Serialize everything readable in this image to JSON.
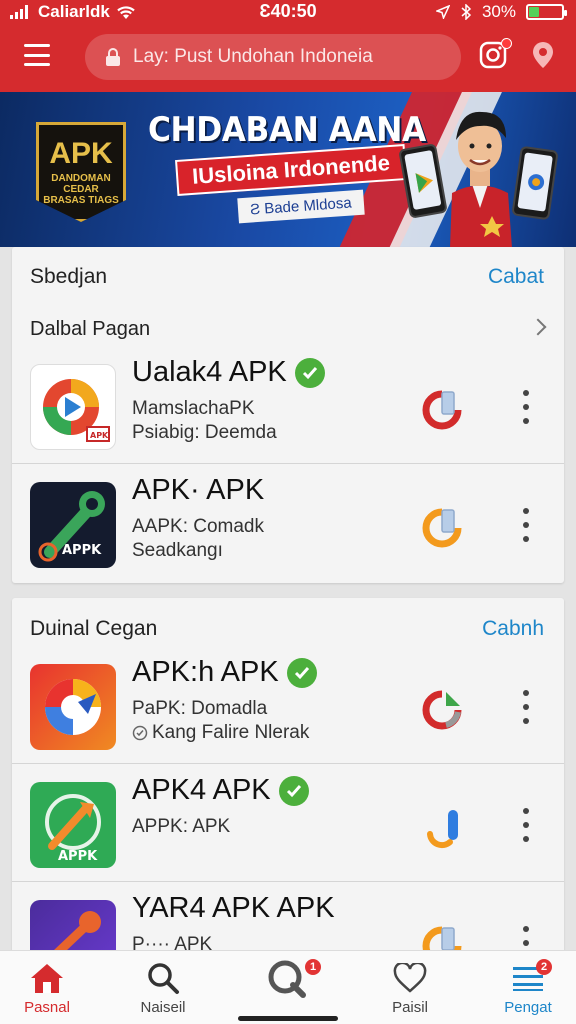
{
  "status_bar": {
    "carrier": "Caliarldk",
    "time": "Ɛ40:50",
    "battery": "30%",
    "battery_level": 0.3
  },
  "header": {
    "search_placeholder": "Lay: Pust Undohan Indoneia",
    "icons": [
      "menu-icon",
      "lock-icon",
      "instagram-icon",
      "location-pin-icon"
    ]
  },
  "banner": {
    "badge_big": "APK",
    "badge_small": "DANDOMAN CEDAR BRASAS TIAGS",
    "title": "CHDABAN AANA",
    "subtitle": "IUsloina Irdonende",
    "tag": "Bade Mldosa"
  },
  "section1": {
    "title": "Sbedjan",
    "link": "Cabat",
    "subtitle": "Dalbal Pagan",
    "items": [
      {
        "name": "Ualak4 APK",
        "verified": true,
        "line1": "MamslachaPK",
        "line2": "Psiabig: Deemda",
        "icon": "play-store-icon",
        "action_color": "#d22b2b"
      },
      {
        "name": "APK· APK",
        "verified": false,
        "line1": "AAPK: Comadk",
        "line2": "Seadkangı",
        "icon": "wrench-apk-icon",
        "action_color": "#f39a1d"
      }
    ]
  },
  "section2": {
    "title": "Duinal Cegan",
    "link": "Cabnh",
    "items": [
      {
        "name": "APK:h APK",
        "verified": true,
        "line1": "PaPK: Domadla",
        "line2": "Kang Falire Nlerak",
        "icon": "chrome-like-icon",
        "action_color": "#d22b2b"
      },
      {
        "name": "APK4 APK",
        "verified": true,
        "line1": "APPK: APK",
        "line2": "",
        "icon": "tool-apk-icon",
        "action_color": "#2f7de0"
      },
      {
        "name": "YAR4 APK APK",
        "verified": false,
        "line1": "P···· APK",
        "line2": "",
        "icon": "wrench-purple-icon",
        "action_color": "#f39a1d"
      }
    ]
  },
  "bottom_nav": [
    {
      "label": "Pasnal",
      "icon": "home-icon",
      "active": true
    },
    {
      "label": "Naiseil",
      "icon": "search-icon",
      "active": false
    },
    {
      "label": "",
      "icon": "search-q-icon",
      "badge": "1",
      "active": false
    },
    {
      "label": "Paisil",
      "icon": "heart-icon",
      "active": false
    },
    {
      "label": "Pengat",
      "icon": "list-icon",
      "badge": "2",
      "active": false
    }
  ],
  "colors": {
    "brand_red": "#d52b2e",
    "link_blue": "#1e86c9",
    "verified_green": "#4caf3c"
  }
}
